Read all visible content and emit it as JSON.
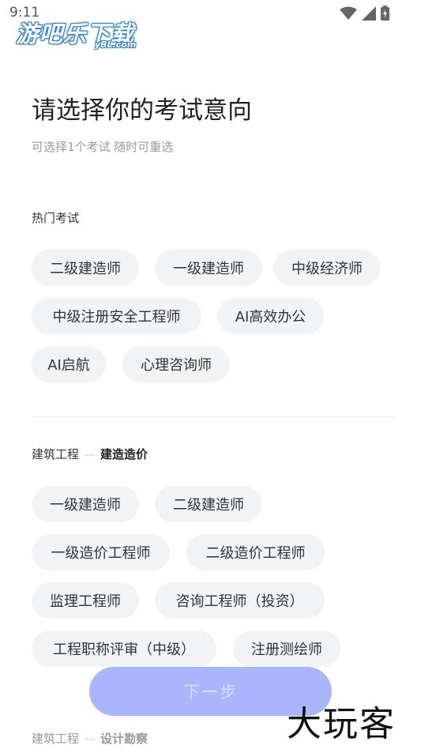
{
  "status_bar": {
    "time": "9:11"
  },
  "watermark": {
    "logo_main": "游吧乐下载",
    "logo_sub": "yBL.com",
    "bottom_text": "大玩客"
  },
  "header": {
    "title": "请选择你的考试意向",
    "subtitle": "可选择1个考试 随时可重选"
  },
  "sections": {
    "hot": {
      "title": "热门考试",
      "chips": [
        "二级建造师",
        "一级建造师",
        "中级经济师",
        "中级注册安全工程师",
        "AI高效办公",
        "AI启航",
        "心理咨询师"
      ]
    },
    "construction_cost": {
      "category": "建筑工程",
      "sub": "建造造价",
      "chips": [
        "一级建造师",
        "二级建造师",
        "一级造价工程师",
        "二级造价工程师",
        "监理工程师",
        "咨询工程师（投资）",
        "工程职称评审（中级）",
        "注册测绘师"
      ]
    },
    "construction_design": {
      "category": "建筑工程",
      "sub": "设计勘察"
    }
  },
  "footer": {
    "next_label": "下一步"
  },
  "colors": {
    "chip_bg": "#f2f3f5",
    "button_disabled": "#a9b6fb",
    "logo_blue": "#2d7fd6"
  }
}
